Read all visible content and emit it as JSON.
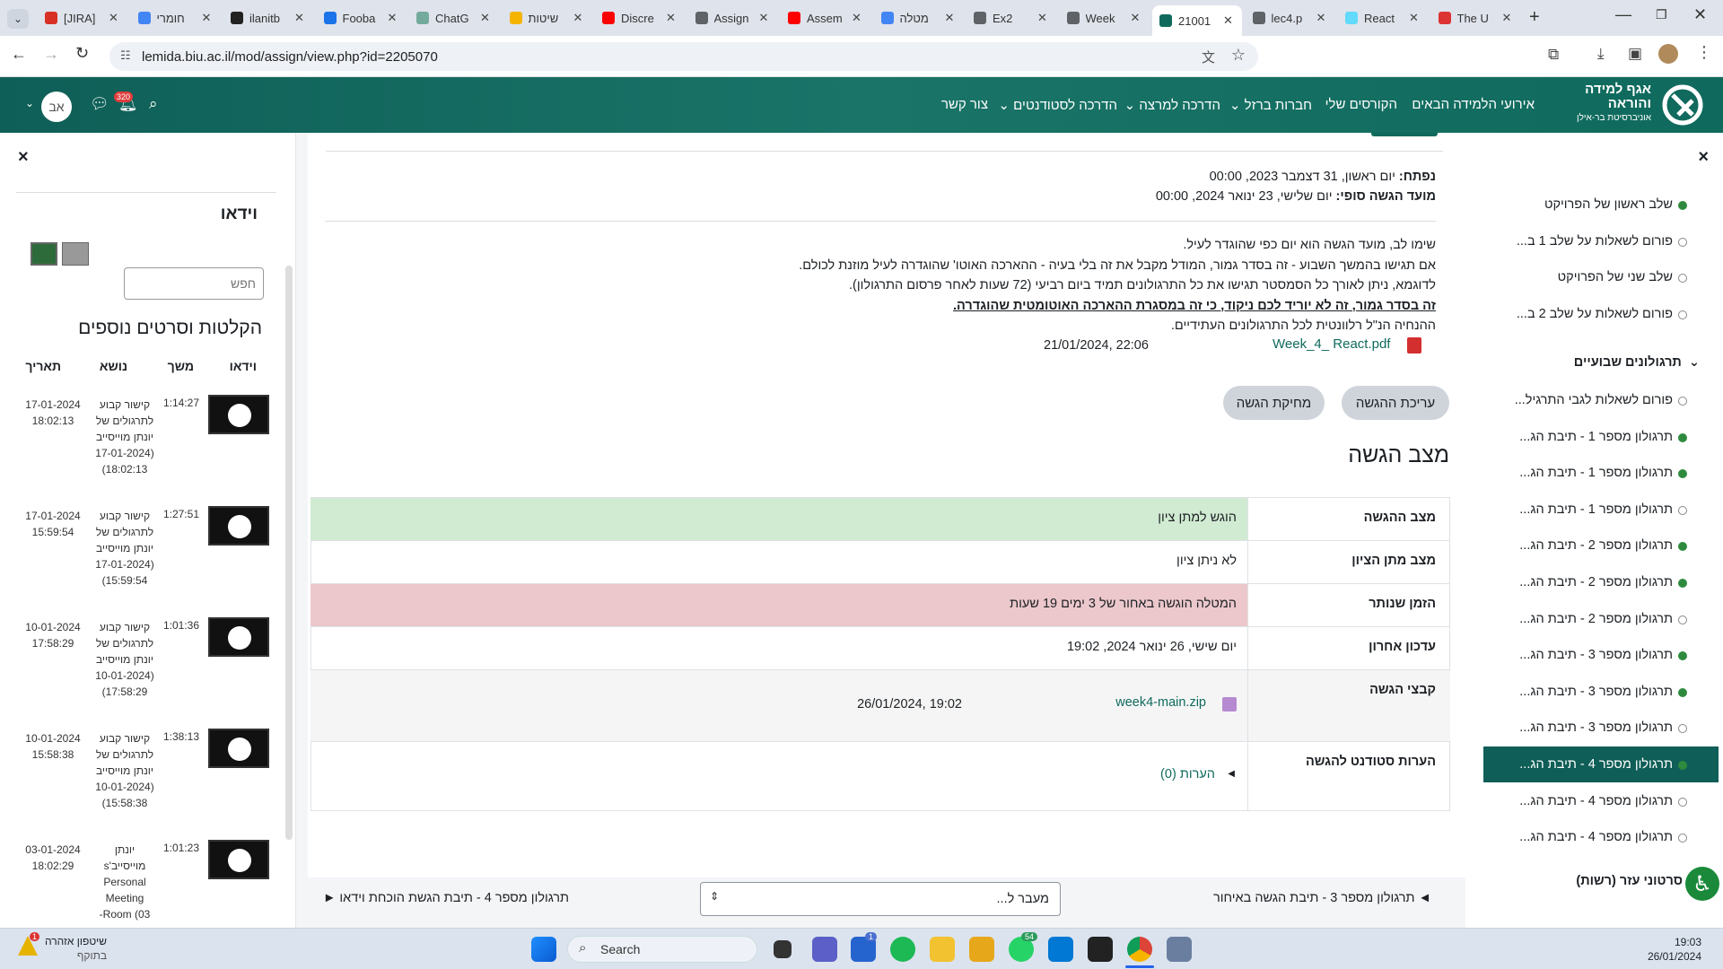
{
  "browser": {
    "tabs": [
      {
        "title": "[JIRA]",
        "icon": "gmail-icon",
        "color": "#d93025"
      },
      {
        "title": "חומרי",
        "icon": "docs-icon",
        "color": "#4285f4"
      },
      {
        "title": "ilanitb",
        "icon": "github-icon",
        "color": "#222222"
      },
      {
        "title": "Fooba",
        "icon": "diamond-icon",
        "color": "#1a73e8"
      },
      {
        "title": "ChatG",
        "icon": "chatgpt-icon",
        "color": "#74aa9c"
      },
      {
        "title": "שיטות",
        "icon": "slides-icon",
        "color": "#f4b400"
      },
      {
        "title": "Discre",
        "icon": "youtube-icon",
        "color": "#ff0000"
      },
      {
        "title": "Assign",
        "icon": "globe-icon",
        "color": "#5f6368"
      },
      {
        "title": "Assem",
        "icon": "youtube-icon",
        "color": "#ff0000"
      },
      {
        "title": "מטלה",
        "icon": "docs-icon",
        "color": "#4285f4"
      },
      {
        "title": "Ex2",
        "icon": "globe-icon",
        "color": "#5f6368"
      },
      {
        "title": "Week",
        "icon": "globe-icon",
        "color": "#5f6368"
      },
      {
        "title": "21001",
        "icon": "moodle-icon",
        "color": "#0f6a5d"
      },
      {
        "title": "lec4.p",
        "icon": "globe-icon",
        "color": "#5f6368"
      },
      {
        "title": "React",
        "icon": "react-icon",
        "color": "#61dafb"
      },
      {
        "title": "The U",
        "icon": "the-u-icon",
        "color": "#d33"
      }
    ],
    "active_tab_index": 12,
    "new_tab_label": "+",
    "url": "lemida.biu.ac.il/mod/assign/view.php?id=2205070"
  },
  "site_nav": {
    "logo_line1": "אגף למידה",
    "logo_line2": "והוראה",
    "logo_line3": "אוניברסיטת בר-אילן",
    "links": [
      "אירועי הלמידה הבאים",
      "הקורסים שלי",
      "חברות ברזל",
      "הדרכה למרצה",
      "הדרכה לסטודנטים",
      "צור קשר"
    ],
    "notification_count": "320",
    "avatar_initials": "אב"
  },
  "left_panel": {
    "close_label": "×",
    "title": "וידאו",
    "search_placeholder": "חפש",
    "section_title": "הקלטות וסרטים נוספים",
    "columns": [
      "וידאו",
      "משך",
      "נושא",
      "תאריך"
    ],
    "rows": [
      {
        "duration": "1:14:27",
        "topic": "קישור קבוע לתרגולים של יונתן מוייסייב (17-01-2024 18:02:13)",
        "date": "17-01-2024 18:02:13"
      },
      {
        "duration": "1:27:51",
        "topic": "קישור קבוע לתרגולים של יונתן מוייסייב (17-01-2024 15:59:54)",
        "date": "17-01-2024 15:59:54"
      },
      {
        "duration": "1:01:36",
        "topic": "קישור קבוע לתרגולים של יונתן מוייסייב (10-01-2024 17:58:29)",
        "date": "10-01-2024 17:58:29"
      },
      {
        "duration": "1:38:13",
        "topic": "קישור קבוע לתרגולים של יונתן מוייסייב (10-01-2024 15:58:38)",
        "date": "10-01-2024 15:58:38"
      },
      {
        "duration": "1:01:23",
        "topic": "יונתן מוייסייב's Personal Meeting Room (03-",
        "date": "03-01-2024 18:02:29"
      }
    ]
  },
  "assignment": {
    "opened_label": "נפתח:",
    "opened_value": "יום ראשון, 31 דצמבר 2023, 00:00",
    "due_label": "מועד הגשה סופי:",
    "due_value": "יום שלישי, 23 ינואר 2024, 00:00",
    "desc_lines": [
      "שימו לב, מועד הגשה הוא יום כפי שהוגדר לעיל.",
      "אם תגישו בהמשך השבוע - זה בסדר גמור, המודל מקבל את זה בלי בעיה - ההארכה האוטו' שהוגדרה לעיל מוזנת לכולם.",
      "לדוגמא, ניתן לאורך כל הסמסטר תגישו את כל התרגולונים תמיד ביום רביעי (72 שעות לאחר פרסום התרגולון).",
      "זה בסדר גמור, זה לא יוריד לכם ניקוד, כי זה במסגרת ההארכה האוטומטית שהוגדרה.",
      "ההנחיה הנ\"ל רלוונטית לכל התרגולונים העתידיים."
    ],
    "attachment_name": "Week_4_ React.pdf",
    "attachment_date": "21/01/2024, 22:06",
    "edit_button": "עריכת ההגשה",
    "delete_button": "מחיקת הגשה",
    "status_heading": "מצב הגשה",
    "status_rows": [
      {
        "label": "מצב ההגשה",
        "value": "הוגש למתן ציון"
      },
      {
        "label": "מצב מתן הציון",
        "value": "לא ניתן ציון"
      },
      {
        "label": "הזמן שנותר",
        "value": "המטלה הוגשה באחור של 3 ימים 19 שעות"
      },
      {
        "label": "עדכון אחרון",
        "value": "יום שישי, 26 ינואר 2024, 19:02"
      },
      {
        "label": "קבצי הגשה",
        "value": "week4-main.zip"
      },
      {
        "label": "הערות סטודנט להגשה",
        "value": "הערות (0)"
      }
    ],
    "submission_file_date": "26/01/2024, 19:02",
    "prev_link": "◄ תרגולון מספר 3 - תיבת הגשה באיחור",
    "jump_placeholder": "מעבר ל...",
    "next_link": "תרגולון מספר 4 - תיבת הגשת הוכחת וידאו ►",
    "status_colors": {
      "success": "#d1ebd2",
      "danger": "#ecc8cc"
    }
  },
  "right_panel": {
    "close_label": "×",
    "items_top": [
      {
        "label": "שלב ראשון של הפרויקט",
        "done": true
      },
      {
        "label": "פורום לשאלות על שלב 1 ב...",
        "done": false
      },
      {
        "label": "שלב שני של הפרויקט",
        "done": false
      },
      {
        "label": "פורום לשאלות על שלב 2 ב...",
        "done": false
      }
    ],
    "section_label": "תרגולונים שבועיים",
    "items": [
      {
        "label": "פורום לשאלות לגבי התרגיל...",
        "done": false
      },
      {
        "label": "תרגולון מספר 1 - תיבת הג...",
        "done": true
      },
      {
        "label": "תרגולון מספר 1 - תיבת הג...",
        "done": true
      },
      {
        "label": "תרגולון מספר 1 - תיבת הג...",
        "done": false
      },
      {
        "label": "תרגולון מספר 2 - תיבת הג...",
        "done": true
      },
      {
        "label": "תרגולון מספר 2 - תיבת הג...",
        "done": true
      },
      {
        "label": "תרגולון מספר 2 - תיבת הג...",
        "done": false
      },
      {
        "label": "תרגולון מספר 3 - תיבת הג...",
        "done": true
      },
      {
        "label": "תרגולון מספר 3 - תיבת הג...",
        "done": true
      },
      {
        "label": "תרגולון מספר 3 - תיבת הג...",
        "done": false
      },
      {
        "label": "תרגולון מספר 4 - תיבת הג...",
        "done": true,
        "active": true
      },
      {
        "label": "תרגולון מספר 4 - תיבת הג...",
        "done": false
      },
      {
        "label": "תרגולון מספר 4 - תיבת הג...",
        "done": false
      }
    ],
    "bottom_label": "סרטוני עזר (רשות)"
  },
  "taskbar": {
    "weather_label": "שיטפון אזהרה",
    "weather_sub": "בתוקף",
    "weather_badge": "1",
    "search_label": "Search",
    "time": "19:03",
    "date": "26/01/2024",
    "badges": {
      "todo": "1",
      "whatsapp": "54"
    }
  }
}
